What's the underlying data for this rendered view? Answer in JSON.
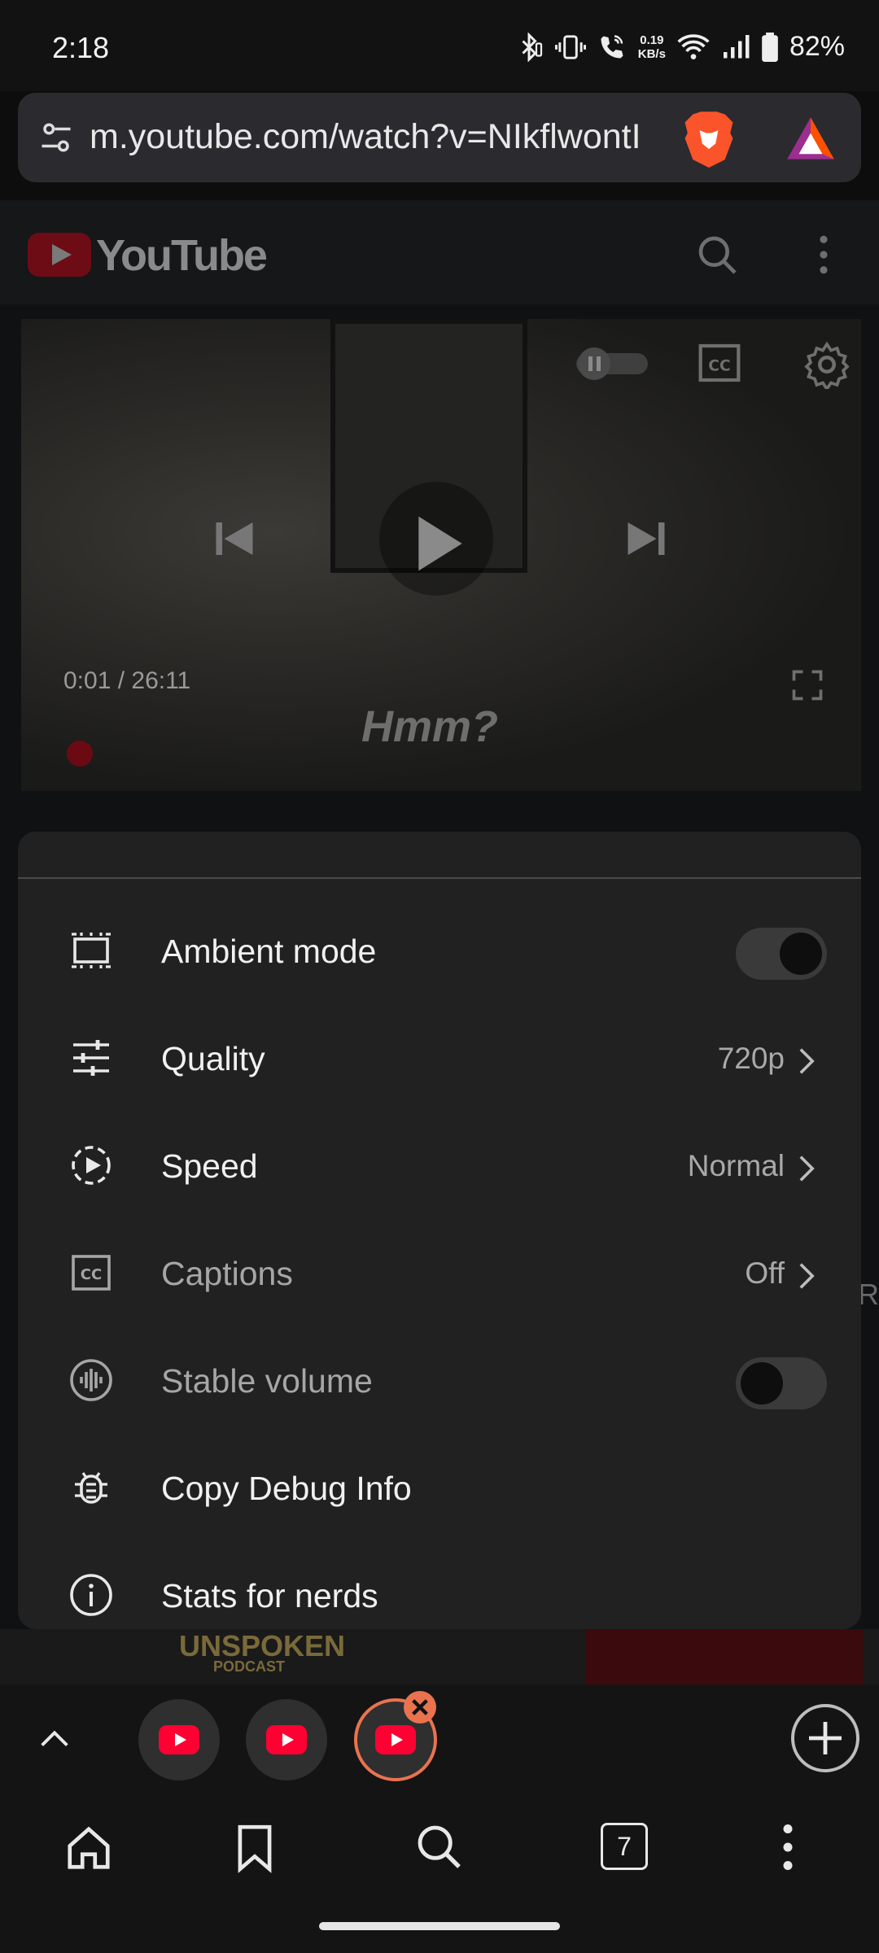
{
  "status_bar": {
    "time": "2:18",
    "net_speed_value": "0.19",
    "net_speed_unit": "KB/s",
    "battery": "82%"
  },
  "address_bar": {
    "url": "m.youtube.com/watch?v=NIkflwontI"
  },
  "youtube_header": {
    "logo_text": "YouTube"
  },
  "video": {
    "timecode": "0:01 / 26:11",
    "subtitle": "Hmm?"
  },
  "settings_menu": {
    "items": [
      {
        "label": "Ambient mode",
        "value": "",
        "control": "toggle",
        "enabled": true
      },
      {
        "label": "Quality",
        "value": "720p",
        "control": "chevron",
        "enabled": true
      },
      {
        "label": "Speed",
        "value": "Normal",
        "control": "chevron",
        "enabled": true
      },
      {
        "label": "Captions",
        "value": "Off",
        "control": "chevron",
        "enabled": false
      },
      {
        "label": "Stable volume",
        "value": "",
        "control": "toggle",
        "enabled": false
      },
      {
        "label": "Copy Debug Info",
        "value": "",
        "control": "none",
        "enabled": true
      },
      {
        "label": "Stats for nerds",
        "value": "",
        "control": "none",
        "enabled": true
      }
    ]
  },
  "background_fragments": {
    "thumbnail_text_1": "UNSPOKEN",
    "thumbnail_text_2": "PODCAST",
    "edge_letter": "R"
  },
  "tabs_bar": {
    "tab_count": "7"
  },
  "colors": {
    "sheet_bg": "#212121",
    "youtube_red": "#ff0033",
    "active_tab_ring": "#e9734f"
  }
}
